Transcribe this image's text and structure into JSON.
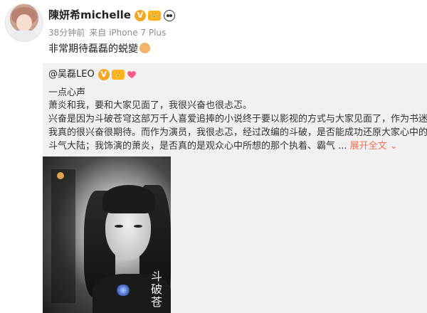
{
  "post": {
    "author": "陳妍希michelle",
    "time": "38分钟前",
    "source": "来自 iPhone 7 Plus",
    "text": "非常期待磊磊的蜕變",
    "badge_v": "V",
    "badge_crown": "👑"
  },
  "repost": {
    "author": "@吴磊LEO",
    "badge_v": "V",
    "badge_crown": "👑",
    "lines": [
      "一点心声",
      "萧炎和我，要和大家见面了，我很兴奋也很忐忑。",
      "兴奋是因为斗破苍穹这部万千人喜爱追捧的小说终于要以影视的方式与大家见面了，作为书迷",
      "我真的很兴奋很期待。而作为演员，我很忐忑，经过改编的斗破，是否能成功还原大家心中的",
      "斗气大陆；我饰演的萧炎，是否真的是观众心中所想的那个执着、霸气 ..."
    ],
    "expand_label": "展开全文 ⌄",
    "poster_calligraphy": "斗破苍"
  },
  "colors": {
    "link": "#eb7350",
    "badge": "#f5a623",
    "heart": "#ff5a8a"
  }
}
